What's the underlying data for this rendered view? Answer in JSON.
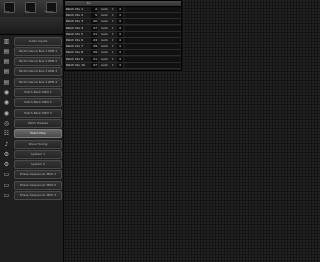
{
  "sidebar": {
    "header": {
      "buttons": [
        {
          "icon": "grid-icon",
          "caption": "Show"
        },
        {
          "icon": "lock-icon",
          "caption": "Lock"
        },
        {
          "icon": "key-icon",
          "caption": "Sequence"
        }
      ]
    },
    "items": [
      {
        "label": "Audio Inputs",
        "icon": "audio-inputs-icon"
      },
      {
        "label": "Performance Bus 1 RPN 1",
        "icon": "performance-bus-icon"
      },
      {
        "label": "Performance Bus 2 RPN 2",
        "icon": "performance-bus-icon"
      },
      {
        "label": "Performance Bus 3 RPN 3",
        "icon": "performance-bus-icon"
      },
      {
        "label": "Performance Bus 4 RPN 4",
        "icon": "performance-bus-icon"
      },
      {
        "label": "Patch Bank MIDI 1",
        "icon": "patch-bank-icon"
      },
      {
        "label": "Patch Bank MIDI 2",
        "icon": "patch-bank-icon"
      },
      {
        "label": "Patch Bank MIDI 3",
        "icon": "patch-bank-icon"
      },
      {
        "label": "Patch Presets",
        "icon": "patch-presets-icon"
      },
      {
        "label": "Patch Map",
        "icon": "patch-map-icon"
      },
      {
        "label": "Show Tuning",
        "icon": "tuning-icon"
      },
      {
        "label": "System 1",
        "icon": "system-icon"
      },
      {
        "label": "System 2",
        "icon": "system-icon"
      },
      {
        "label": "Phase Sequencer MIDI 1",
        "icon": "midi-icon"
      },
      {
        "label": "Phase Sequencer MIDI 2",
        "icon": "midi-icon"
      },
      {
        "label": "Phase Sequencer MIDI 3",
        "icon": "midi-icon"
      }
    ],
    "active_index": 9
  },
  "table": {
    "header": "Lo",
    "rows": [
      {
        "name": "Patch Div 1",
        "num": "2",
        "type": "num",
        "value": "4"
      },
      {
        "name": "Patch Div 2",
        "num": "5",
        "type": "num",
        "value": "4"
      },
      {
        "name": "Patch Div 3",
        "num": "20",
        "type": "num",
        "value": "4"
      },
      {
        "name": "Patch Div 4",
        "num": "27",
        "type": "num",
        "value": "4"
      },
      {
        "name": "Patch Div 5",
        "num": "21",
        "type": "num",
        "value": "4"
      },
      {
        "name": "Patch Div 6",
        "num": "24",
        "type": "num",
        "value": "4"
      },
      {
        "name": "Patch Div 7",
        "num": "29",
        "type": "num",
        "value": "4"
      },
      {
        "name": "Patch Div 8",
        "num": "29",
        "type": "num",
        "value": "4"
      },
      {
        "name": "Patch Div 9",
        "num": "21",
        "type": "num",
        "value": "4"
      },
      {
        "name": "Patch Div 10",
        "num": "27",
        "type": "num",
        "value": "4"
      }
    ]
  }
}
